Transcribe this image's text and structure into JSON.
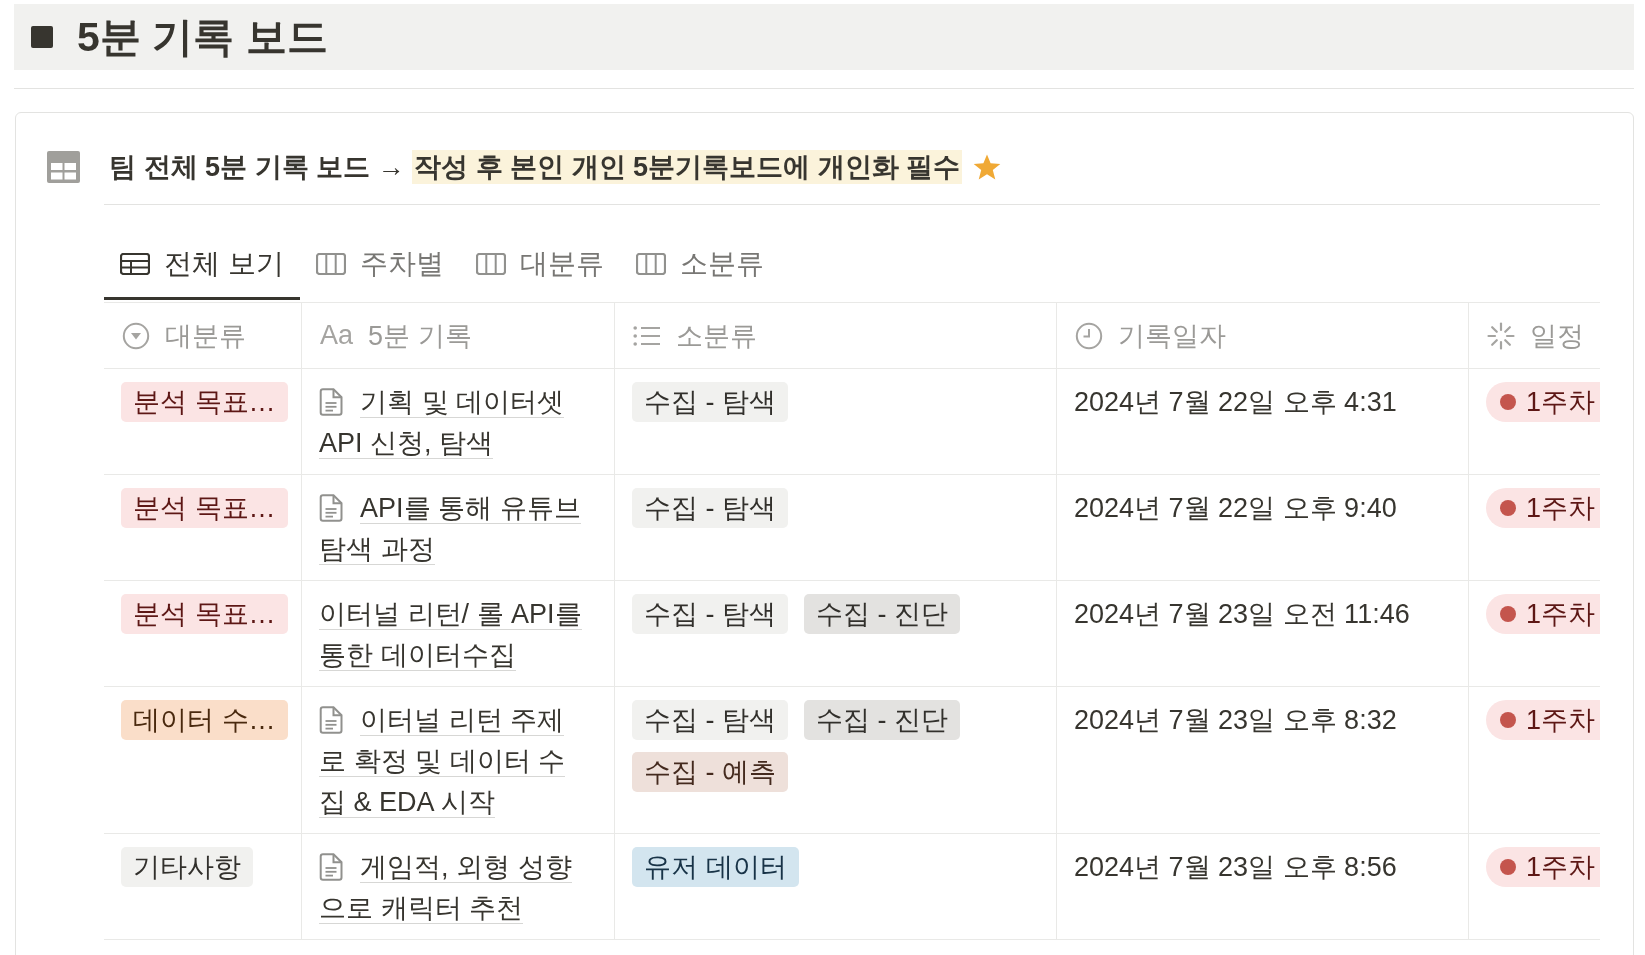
{
  "page": {
    "title": "5분 기록 보드"
  },
  "database": {
    "title": [
      {
        "text": "팀 전체 5분 기록 보드 →",
        "highlighted": false
      },
      {
        "text": "작성 후 본인 개인 5분기록보드에 개인화 필수",
        "highlighted": true
      }
    ],
    "tabs": [
      {
        "label": "전체 보기",
        "kind": "table",
        "selected": true
      },
      {
        "label": "주차별",
        "kind": "board",
        "selected": false
      },
      {
        "label": "대분류",
        "kind": "board",
        "selected": false
      },
      {
        "label": "소분류",
        "kind": "board",
        "selected": false
      }
    ],
    "columns": [
      {
        "label": "대분류",
        "kind": "select"
      },
      {
        "label": "5분 기록",
        "kind": "title",
        "icon_text": "Aa"
      },
      {
        "label": "소분류",
        "kind": "multi_select"
      },
      {
        "label": "기록일자",
        "kind": "date"
      },
      {
        "label": "일정",
        "kind": "status"
      }
    ],
    "rows": [
      {
        "category": {
          "label": "분석 목표…",
          "color": "#fbe4e4"
        },
        "title": {
          "text": "기획 및 데이터셋 API 신청, 탐색",
          "page_icon": true
        },
        "subcategories": [
          {
            "label": "수집 - 탐색",
            "color": "#f1f1ef"
          }
        ],
        "date": "2024년 7월 22일 오후 4:31",
        "schedule": {
          "label": "1주차",
          "color": "#c4554d"
        }
      },
      {
        "category": {
          "label": "분석 목표…",
          "color": "#fbe4e4"
        },
        "title": {
          "text": "API를 통해 유튜브 탐색 과정",
          "page_icon": true
        },
        "subcategories": [
          {
            "label": "수집 - 탐색",
            "color": "#f1f1ef"
          }
        ],
        "date": "2024년 7월 22일 오후 9:40",
        "schedule": {
          "label": "1주차",
          "color": "#c4554d"
        }
      },
      {
        "category": {
          "label": "분석 목표…",
          "color": "#fbe4e4"
        },
        "title": {
          "text": "이터널 리턴/ 롤 API를 통한 데이터수집",
          "page_icon": false
        },
        "subcategories": [
          {
            "label": "수집 - 탐색",
            "color": "#f1f1ef"
          },
          {
            "label": "수집 - 진단",
            "color": "#e3e2e0"
          }
        ],
        "date": "2024년 7월 23일 오전 11:46",
        "schedule": {
          "label": "1주차",
          "color": "#c4554d"
        }
      },
      {
        "category": {
          "label": "데이터 수…",
          "color": "#fadec9"
        },
        "title": {
          "text": "이터널 리턴 주제로 확정 및 데이터 수집 & EDA 시작",
          "page_icon": true
        },
        "subcategories": [
          {
            "label": "수집 - 탐색",
            "color": "#f1f1ef"
          },
          {
            "label": "수집 - 진단",
            "color": "#e3e2e0"
          },
          {
            "label": "수집 - 예측",
            "color": "#eee0da"
          }
        ],
        "date": "2024년 7월 23일 오후 8:32",
        "schedule": {
          "label": "1주차",
          "color": "#c4554d"
        }
      },
      {
        "category": {
          "label": "기타사항",
          "color": "#f1f1ef"
        },
        "title": {
          "text": "게임적, 외형 성향으로 캐릭터 추천",
          "page_icon": true
        },
        "subcategories": [
          {
            "label": "유저 데이터",
            "color": "#d3e5ef"
          }
        ],
        "date": "2024년 7월 23일 오후 8:56",
        "schedule": {
          "label": "1주차",
          "color": "#c4554d"
        }
      }
    ]
  }
}
